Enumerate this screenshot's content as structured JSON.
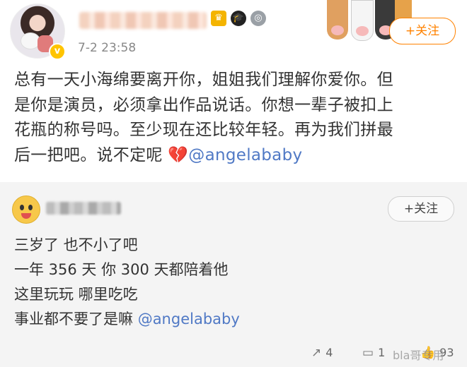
{
  "post": {
    "timestamp": "7-2 23:58",
    "verified_badge": "v",
    "follow_label": "+关注",
    "text_lines": [
      "总有一天小海绵要离开你，姐姐我们理解你爱你。但",
      "是你是演员，必须拿出作品说话。你想一辈子被扣上",
      "花瓶的称号吗。至少现在还比较年轻。再为我们拼最",
      "后一把吧。说不定呢"
    ],
    "broken_heart_emoji": "💔",
    "mention": "@angelababy"
  },
  "repost": {
    "follow_label": "+关注",
    "lines": [
      "三岁了 也不小了吧",
      "一年 356 天 你 300 天都陪着他",
      "这里玩玩 哪里吃吃",
      "事业都不要了是嘛"
    ],
    "mention": "@angelababy",
    "footer": {
      "repost_icon": "↗",
      "repost_count": "4",
      "comment_icon": "▭",
      "comment_count": "1",
      "like_icon": "👍",
      "like_count": "93"
    },
    "watermark": "bla哥专用"
  },
  "colors": {
    "accent_orange": "#ff8200",
    "mention_blue": "#5079c5",
    "repost_bg": "#f4f4f4"
  }
}
